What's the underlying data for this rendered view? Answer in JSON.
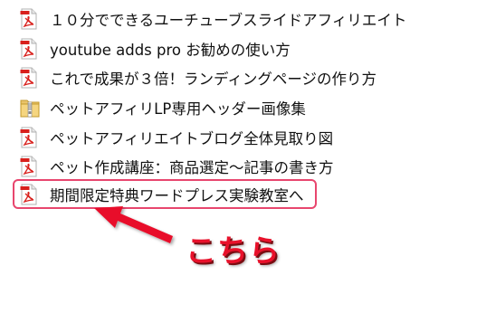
{
  "files": [
    {
      "icon": "pdf-icon",
      "name": "１０分でできるユーチューブスライドアフィリエイト"
    },
    {
      "icon": "pdf-icon",
      "name": "youtube adds pro お勧めの使い方"
    },
    {
      "icon": "pdf-icon",
      "name": "これで成果が３倍！ランディングページの作り方"
    },
    {
      "icon": "zip-folder-icon",
      "name": "ペットアフィリLP専用ヘッダー画像集"
    },
    {
      "icon": "pdf-icon",
      "name": "ペットアフィリエイトブログ全体見取り図"
    },
    {
      "icon": "pdf-icon",
      "name": "ペット作成講座：商品選定～記事の書き方"
    },
    {
      "icon": "pdf-icon",
      "name": "期間限定特典ワードプレス実験教室へ"
    }
  ],
  "annotation": {
    "callout_text": "こちら",
    "highlight_color": "#e8466e",
    "callout_color": "#e8112b"
  }
}
